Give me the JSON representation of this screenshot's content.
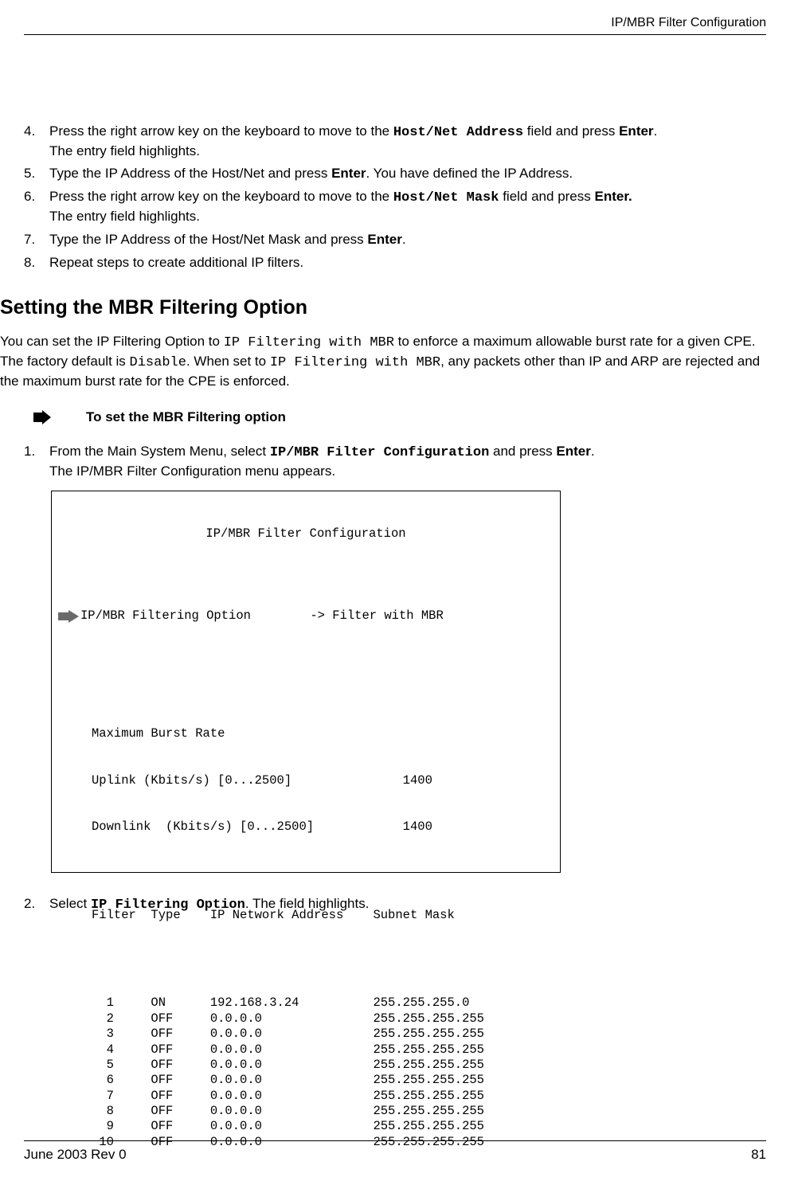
{
  "header": {
    "title": "IP/MBR Filter Configuration"
  },
  "steps_a": [
    {
      "n": "4.",
      "html": "Press the right arrow key on the keyboard to move to the <span class='mono'><b>Host/Net Address</b></span> field and press <b>Enter</b>.<br>The entry field highlights."
    },
    {
      "n": "5.",
      "html": "Type the IP Address of the Host/Net and press <b>Enter</b>. You have defined the IP Address."
    },
    {
      "n": "6.",
      "html": "Press the right arrow key on the keyboard to move to the <span class='mono'><b>Host/Net Mask</b></span> field and press <b>Enter.</b><br>The entry field highlights."
    },
    {
      "n": "7.",
      "html": "Type the IP Address of the Host/Net Mask and press <b>Enter</b>."
    },
    {
      "n": "8.",
      "html": "Repeat steps to create additional IP filters."
    }
  ],
  "section": {
    "title": "Setting the MBR Filtering Option"
  },
  "intro": "You can set the IP Filtering Option to <span class='mono'>IP Filtering with MBR</span> to enforce a maximum allowable burst rate for a given CPE. The factory default is <span class='mono'>Disable</span>. When set to <span class='mono'>IP Filtering with MBR</span>, any packets other than IP and ARP are rejected and the maximum burst rate for the CPE is enforced.",
  "task": {
    "label": "To set the MBR Filtering option"
  },
  "steps_b": [
    {
      "n": "1.",
      "html": "From the Main System Menu, select <span class='mono'><b>IP/MBR Filter Configuration</b></span> and press <b>Enter</b>.<br>The IP/MBR Filter Configuration menu appears."
    }
  ],
  "terminal": {
    "title": "IP/MBR Filter Configuration",
    "option_line": "IP/MBR Filtering Option        -> Filter with MBR",
    "mbr_label": "Maximum Burst Rate",
    "uplink": "Uplink (Kbits/s) [0...2500]               1400",
    "downlink": "Downlink  (Kbits/s) [0...2500]            1400",
    "columns": "Filter  Type    IP Network Address    Subnet Mask",
    "rows": [
      "  1     ON      192.168.3.24          255.255.255.0",
      "  2     OFF     0.0.0.0               255.255.255.255",
      "  3     OFF     0.0.0.0               255.255.255.255",
      "  4     OFF     0.0.0.0               255.255.255.255",
      "  5     OFF     0.0.0.0               255.255.255.255",
      "  6     OFF     0.0.0.0               255.255.255.255",
      "  7     OFF     0.0.0.0               255.255.255.255",
      "  8     OFF     0.0.0.0               255.255.255.255",
      "  9     OFF     0.0.0.0               255.255.255.255",
      " 10     OFF     0.0.0.0               255.255.255.255"
    ]
  },
  "steps_c": [
    {
      "n": "2.",
      "html": "Select <span class='mono'><b>IP Filtering Option</b></span>. The field highlights."
    }
  ],
  "footer": {
    "left": "June 2003 Rev 0",
    "right": "81"
  },
  "chart_data": {
    "type": "table",
    "title": "IP/MBR Filter Configuration",
    "option": "Filter with MBR",
    "maximum_burst_rate": {
      "uplink_kbits_s": 1400,
      "downlink_kbits_s": 1400,
      "range": [
        0,
        2500
      ]
    },
    "columns": [
      "Filter",
      "Type",
      "IP Network Address",
      "Subnet Mask"
    ],
    "rows": [
      [
        1,
        "ON",
        "192.168.3.24",
        "255.255.255.0"
      ],
      [
        2,
        "OFF",
        "0.0.0.0",
        "255.255.255.255"
      ],
      [
        3,
        "OFF",
        "0.0.0.0",
        "255.255.255.255"
      ],
      [
        4,
        "OFF",
        "0.0.0.0",
        "255.255.255.255"
      ],
      [
        5,
        "OFF",
        "0.0.0.0",
        "255.255.255.255"
      ],
      [
        6,
        "OFF",
        "0.0.0.0",
        "255.255.255.255"
      ],
      [
        7,
        "OFF",
        "0.0.0.0",
        "255.255.255.255"
      ],
      [
        8,
        "OFF",
        "0.0.0.0",
        "255.255.255.255"
      ],
      [
        9,
        "OFF",
        "0.0.0.0",
        "255.255.255.255"
      ],
      [
        10,
        "OFF",
        "0.0.0.0",
        "255.255.255.255"
      ]
    ]
  }
}
